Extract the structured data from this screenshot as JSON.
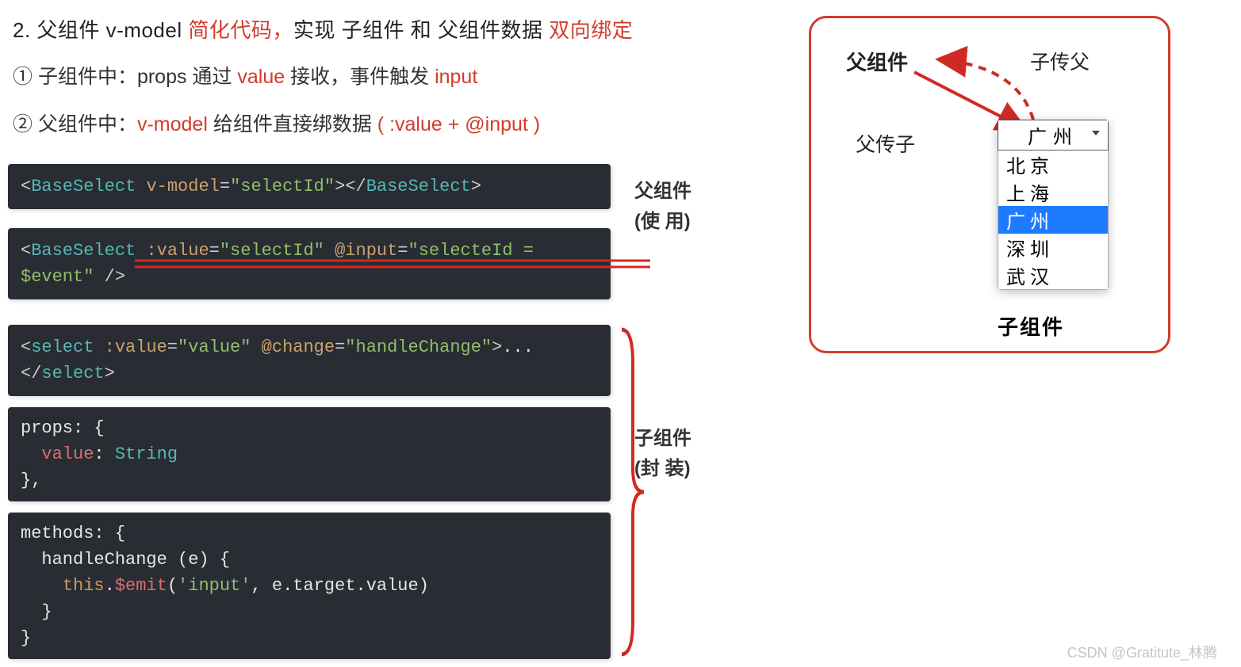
{
  "heading": {
    "num": "2. ",
    "p1": "父组件 v-model ",
    "red1": "简化代码，",
    "p2": "实现 子组件 和 父组件数据 ",
    "red2": "双向绑定"
  },
  "line1": {
    "num": "① ",
    "p1": "子组件中：props 通过 ",
    "red1": "value",
    "p2": " 接收，事件触发 ",
    "red2": "input"
  },
  "line2": {
    "num": "② ",
    "p1": "父组件中：",
    "red1": "v-model",
    "p2": " 给组件直接绑数据   ",
    "red2": "( :value + @input )"
  },
  "labels": {
    "parent": "父组件",
    "use": "(使   用)",
    "child": "子组件",
    "wrap": "(封   装)"
  },
  "code": {
    "c1": {
      "tag": "BaseSelect",
      "attr": "v-model",
      "val": "\"selectId\""
    },
    "c2": {
      "tag": "BaseSelect",
      "a1": ":value",
      "v1": "\"selectId\"",
      "a2": "@input",
      "v2": "\"selecteId = $event\""
    },
    "c3": {
      "tag": "select",
      "a1": ":value",
      "v1": "\"value\"",
      "a2": "@change",
      "v2": "\"handleChange\"",
      "dots": "..."
    },
    "c4": {
      "l1": "props: {",
      "l2": "  ",
      "k": "value",
      "colon": ": ",
      "t": "String",
      "l3": "},"
    },
    "c5": {
      "l1": "methods: {",
      "l2": "  handleChange (e) {",
      "l3a": "    ",
      "this": "this",
      "dot": ".",
      "emit": "$emit",
      "op": "(",
      "s": "'input'",
      "comma": ", e.target.value)",
      "l4": "  }",
      "l5": "}"
    }
  },
  "diagram": {
    "parent": "父组件",
    "childToParent": "子传父",
    "parentToChild": "父传子",
    "selected": "广州",
    "options": [
      "北京",
      "上海",
      "广州",
      "深圳",
      "武汉"
    ],
    "childCaption": "子组件"
  },
  "watermark": "CSDN @Gratitute_林腾"
}
